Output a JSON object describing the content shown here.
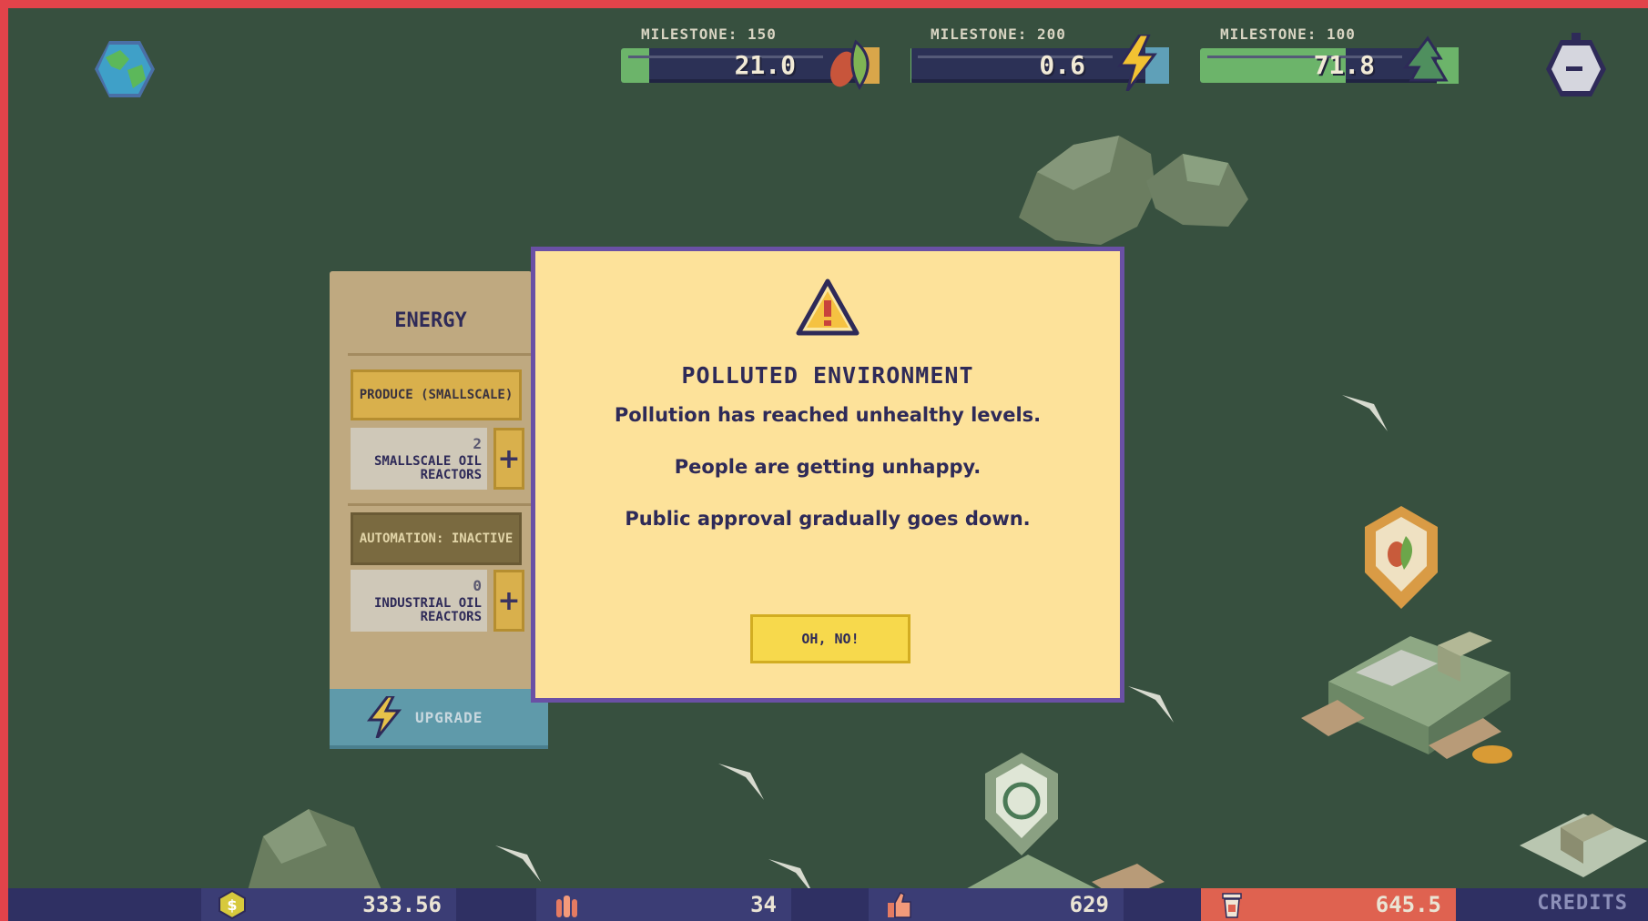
{
  "hud": {
    "milestones": [
      {
        "label": "MILESTONE: 150",
        "value": "21.0",
        "progress": 0.14,
        "icon": "food-leaf-icon"
      },
      {
        "label": "MILESTONE: 200",
        "value": "0.6",
        "progress": 0.003,
        "icon": "energy-bolt-icon"
      },
      {
        "label": "MILESTONE: 100",
        "value": "71.8",
        "progress": 0.718,
        "icon": "recycle-icon"
      }
    ],
    "globe_icon": "globe-icon",
    "timer_icon": "stopwatch-icon"
  },
  "side_panel": {
    "title": "ENERGY",
    "produce_button": "PRODUCE (SMALLSCALE)",
    "smallscale": {
      "count": "2",
      "label": "SMALLSCALE OIL REACTORS"
    },
    "automation_button": "AUTOMATION: INACTIVE",
    "industrial": {
      "count": "0",
      "label": "INDUSTRIAL OIL REACTORS"
    },
    "upgrade_button": "UPGRADE"
  },
  "modal": {
    "title": "POLLUTED ENVIRONMENT",
    "lines": [
      "Pollution has reached unhealthy levels.",
      "People are getting unhappy.",
      "Public approval gradually goes down."
    ],
    "button": "OH, NO!"
  },
  "bottom_bar": {
    "money": "333.56",
    "population": "34",
    "approval": "629",
    "waste": "645.5",
    "credits": "CREDITS"
  },
  "colors": {
    "background": "#37503f",
    "frame": "#e2434a",
    "modal_bg": "#fde29a",
    "modal_border": "#6a50a5",
    "bar_bg": "#2f3063",
    "waste_bg": "#df6250"
  }
}
